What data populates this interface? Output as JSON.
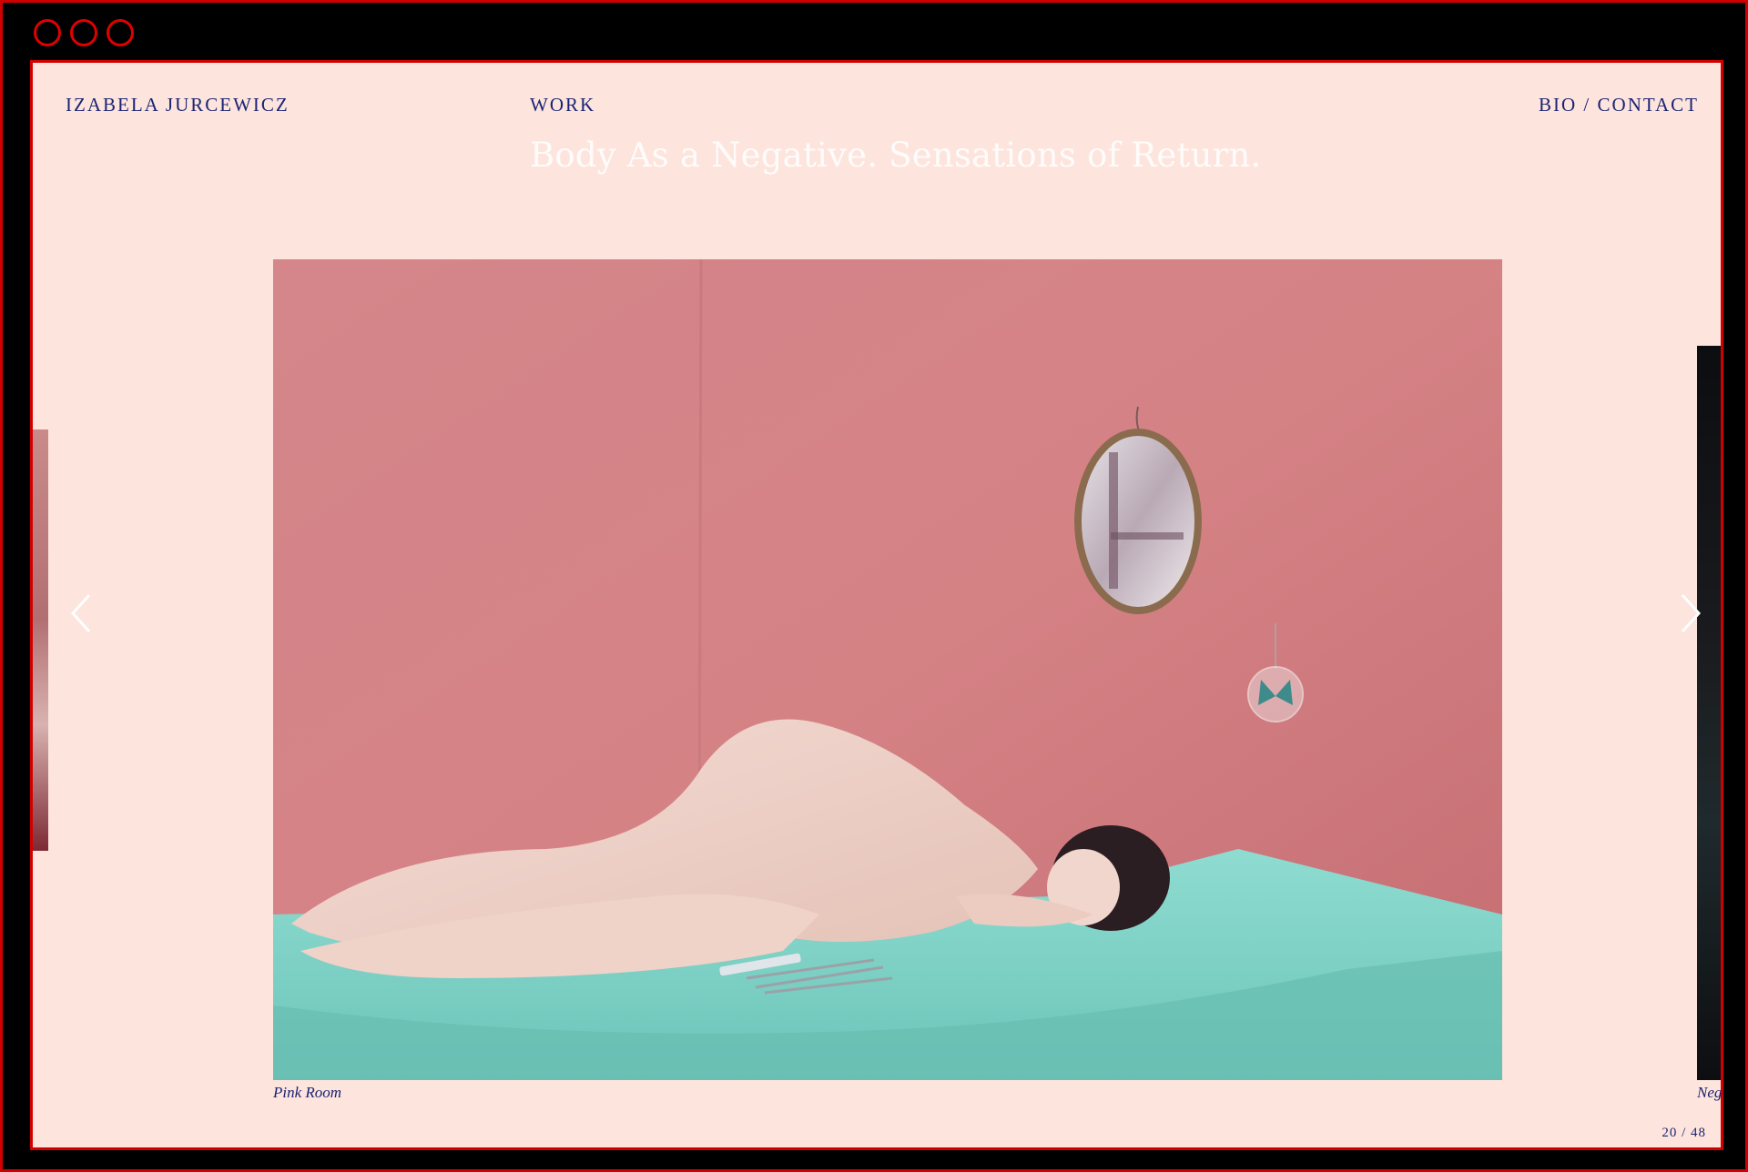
{
  "nav": {
    "brand": "IZABELA JURCEWICZ",
    "work": "WORK",
    "bio_contact": "BIO / CONTACT"
  },
  "project": {
    "title": "Body As a Negative. Sensations of Return."
  },
  "slide": {
    "caption": "Pink Room",
    "next_caption": "Negative",
    "counter": "20 / 48"
  },
  "icons": {
    "prev": "chevron-left-icon",
    "next": "chevron-right-icon"
  },
  "colors": {
    "page_bg": "#fde4dd",
    "nav_text": "#1b2474",
    "frame": "#d10000",
    "wall": "#d17d80",
    "sheet": "#7fd3c8"
  }
}
